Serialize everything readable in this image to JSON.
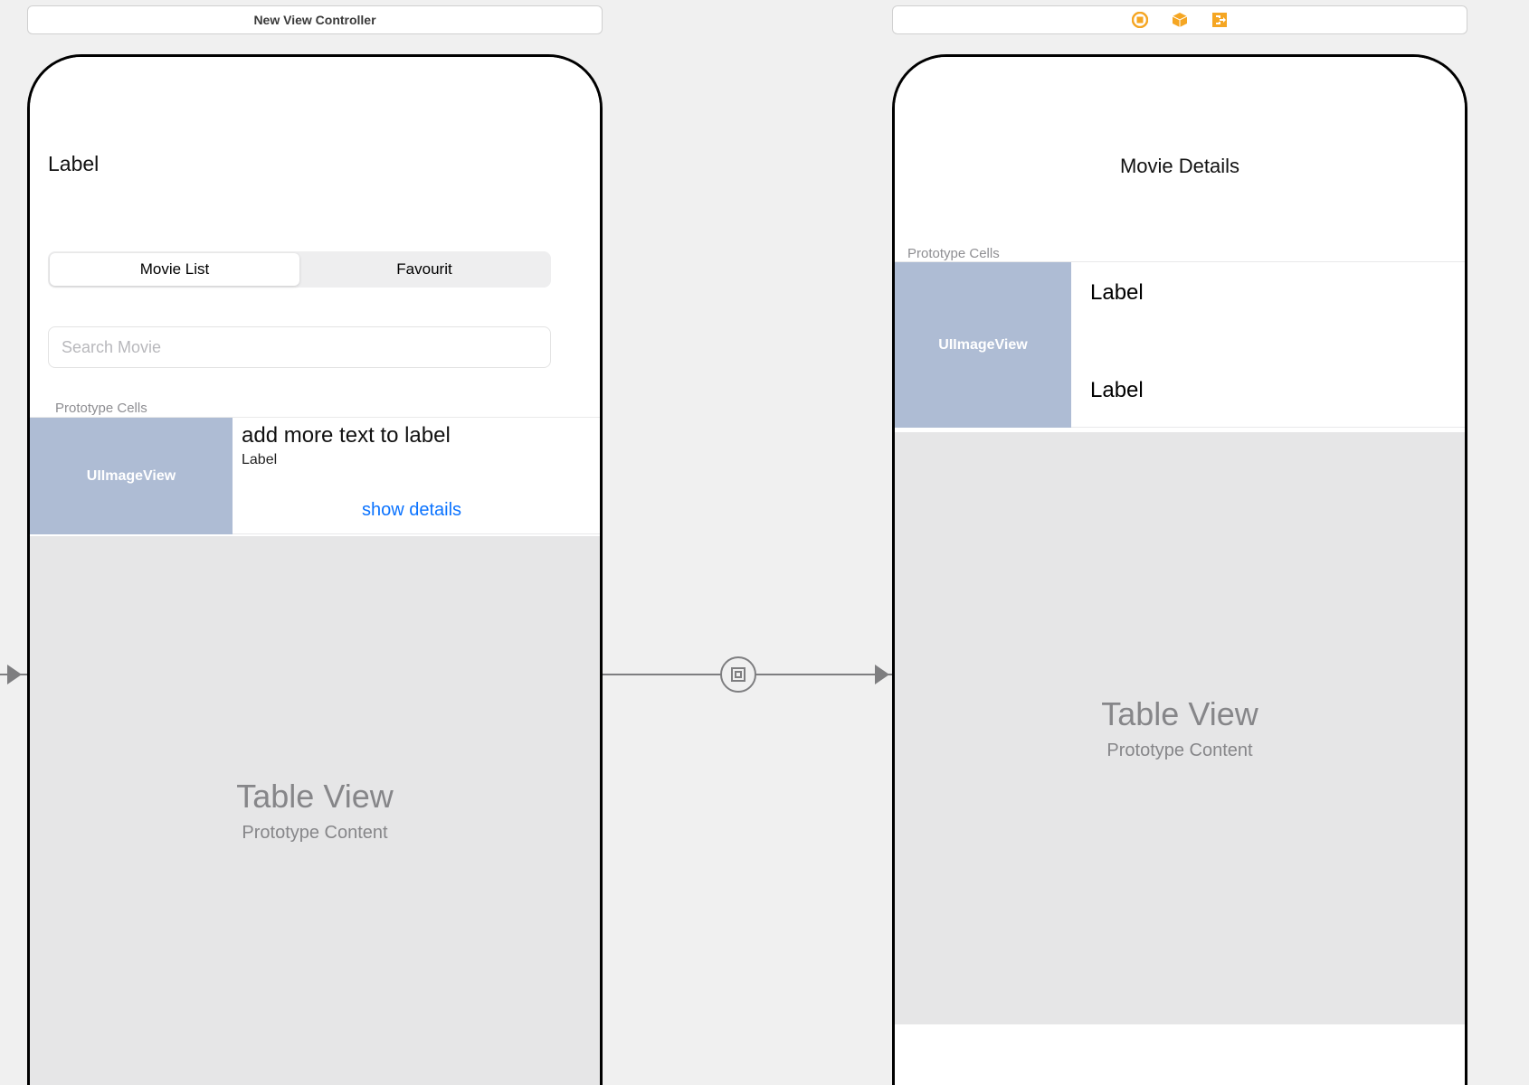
{
  "left_header": "New View Controller",
  "right_header_icons": [
    "square-circle-icon",
    "cube-icon",
    "exit-icon"
  ],
  "left_screen": {
    "title": "Label",
    "segment": {
      "tab1": "Movie List",
      "tab2": "Favourit"
    },
    "search_placeholder": "Search Movie",
    "prototype_label": "Prototype Cells",
    "cell": {
      "image_placeholder": "UIImageView",
      "title": "add more text to label",
      "subtitle": "Label",
      "link": "show details"
    },
    "tableview": {
      "title": "Table View",
      "subtitle": "Prototype Content"
    }
  },
  "right_screen": {
    "nav_title": "Movie Details",
    "prototype_label": "Prototype Cells",
    "cell": {
      "image_placeholder": "UIImageView",
      "label1": "Label",
      "label2": "Label"
    },
    "tableview": {
      "title": "Table View",
      "subtitle": "Prototype Content"
    }
  },
  "colors": {
    "image_fill": "#aebcd4",
    "link": "#0b73ff",
    "orange": "#f5a623"
  }
}
